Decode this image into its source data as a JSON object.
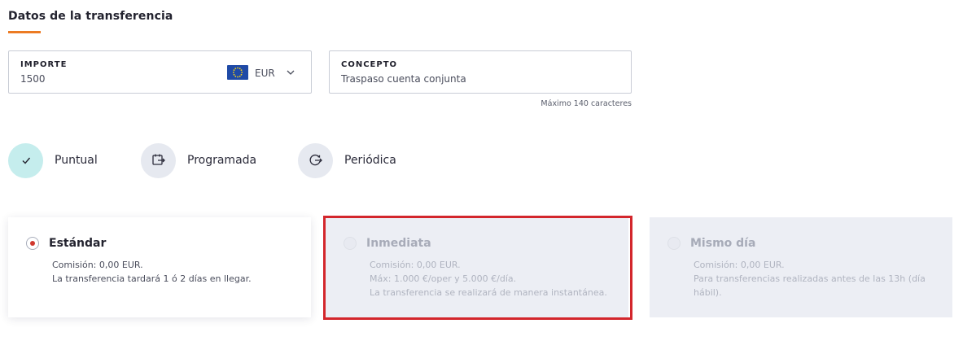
{
  "section": {
    "title": "Datos de la transferencia"
  },
  "amount": {
    "label": "IMPORTE",
    "value": "1500",
    "currency": "EUR"
  },
  "concept": {
    "label": "CONCEPTO",
    "value": "Traspaso cuenta conjunta",
    "hint": "Máximo 140 caracteres"
  },
  "frequency": {
    "options": [
      {
        "label": "Puntual",
        "selected": true,
        "icon": "check-icon"
      },
      {
        "label": "Programada",
        "selected": false,
        "icon": "calendar-transfer-icon"
      },
      {
        "label": "Periódica",
        "selected": false,
        "icon": "calendar-repeat-icon"
      }
    ]
  },
  "transfer_types": [
    {
      "title": "Estándar",
      "selected": true,
      "disabled": false,
      "lines": [
        "Comisión: 0,00 EUR.",
        "La transferencia tardará 1 ó 2 días en llegar."
      ]
    },
    {
      "title": "Inmediata",
      "selected": false,
      "disabled": true,
      "lines": [
        "Comisión: 0,00 EUR.",
        "Máx: 1.000 €/oper y 5.000 €/día.",
        "La transferencia se realizará de manera instantánea."
      ]
    },
    {
      "title": "Mismo día",
      "selected": false,
      "disabled": true,
      "lines": [
        "Comisión: 0,00 EUR.",
        "Para transferencias realizadas antes de las 13h (día hábil)."
      ]
    }
  ],
  "colors": {
    "accent": "#ec7b23",
    "selected_radio": "#d0392f",
    "highlight_border": "#d3262c",
    "selected_option_bg": "#c5eded"
  }
}
